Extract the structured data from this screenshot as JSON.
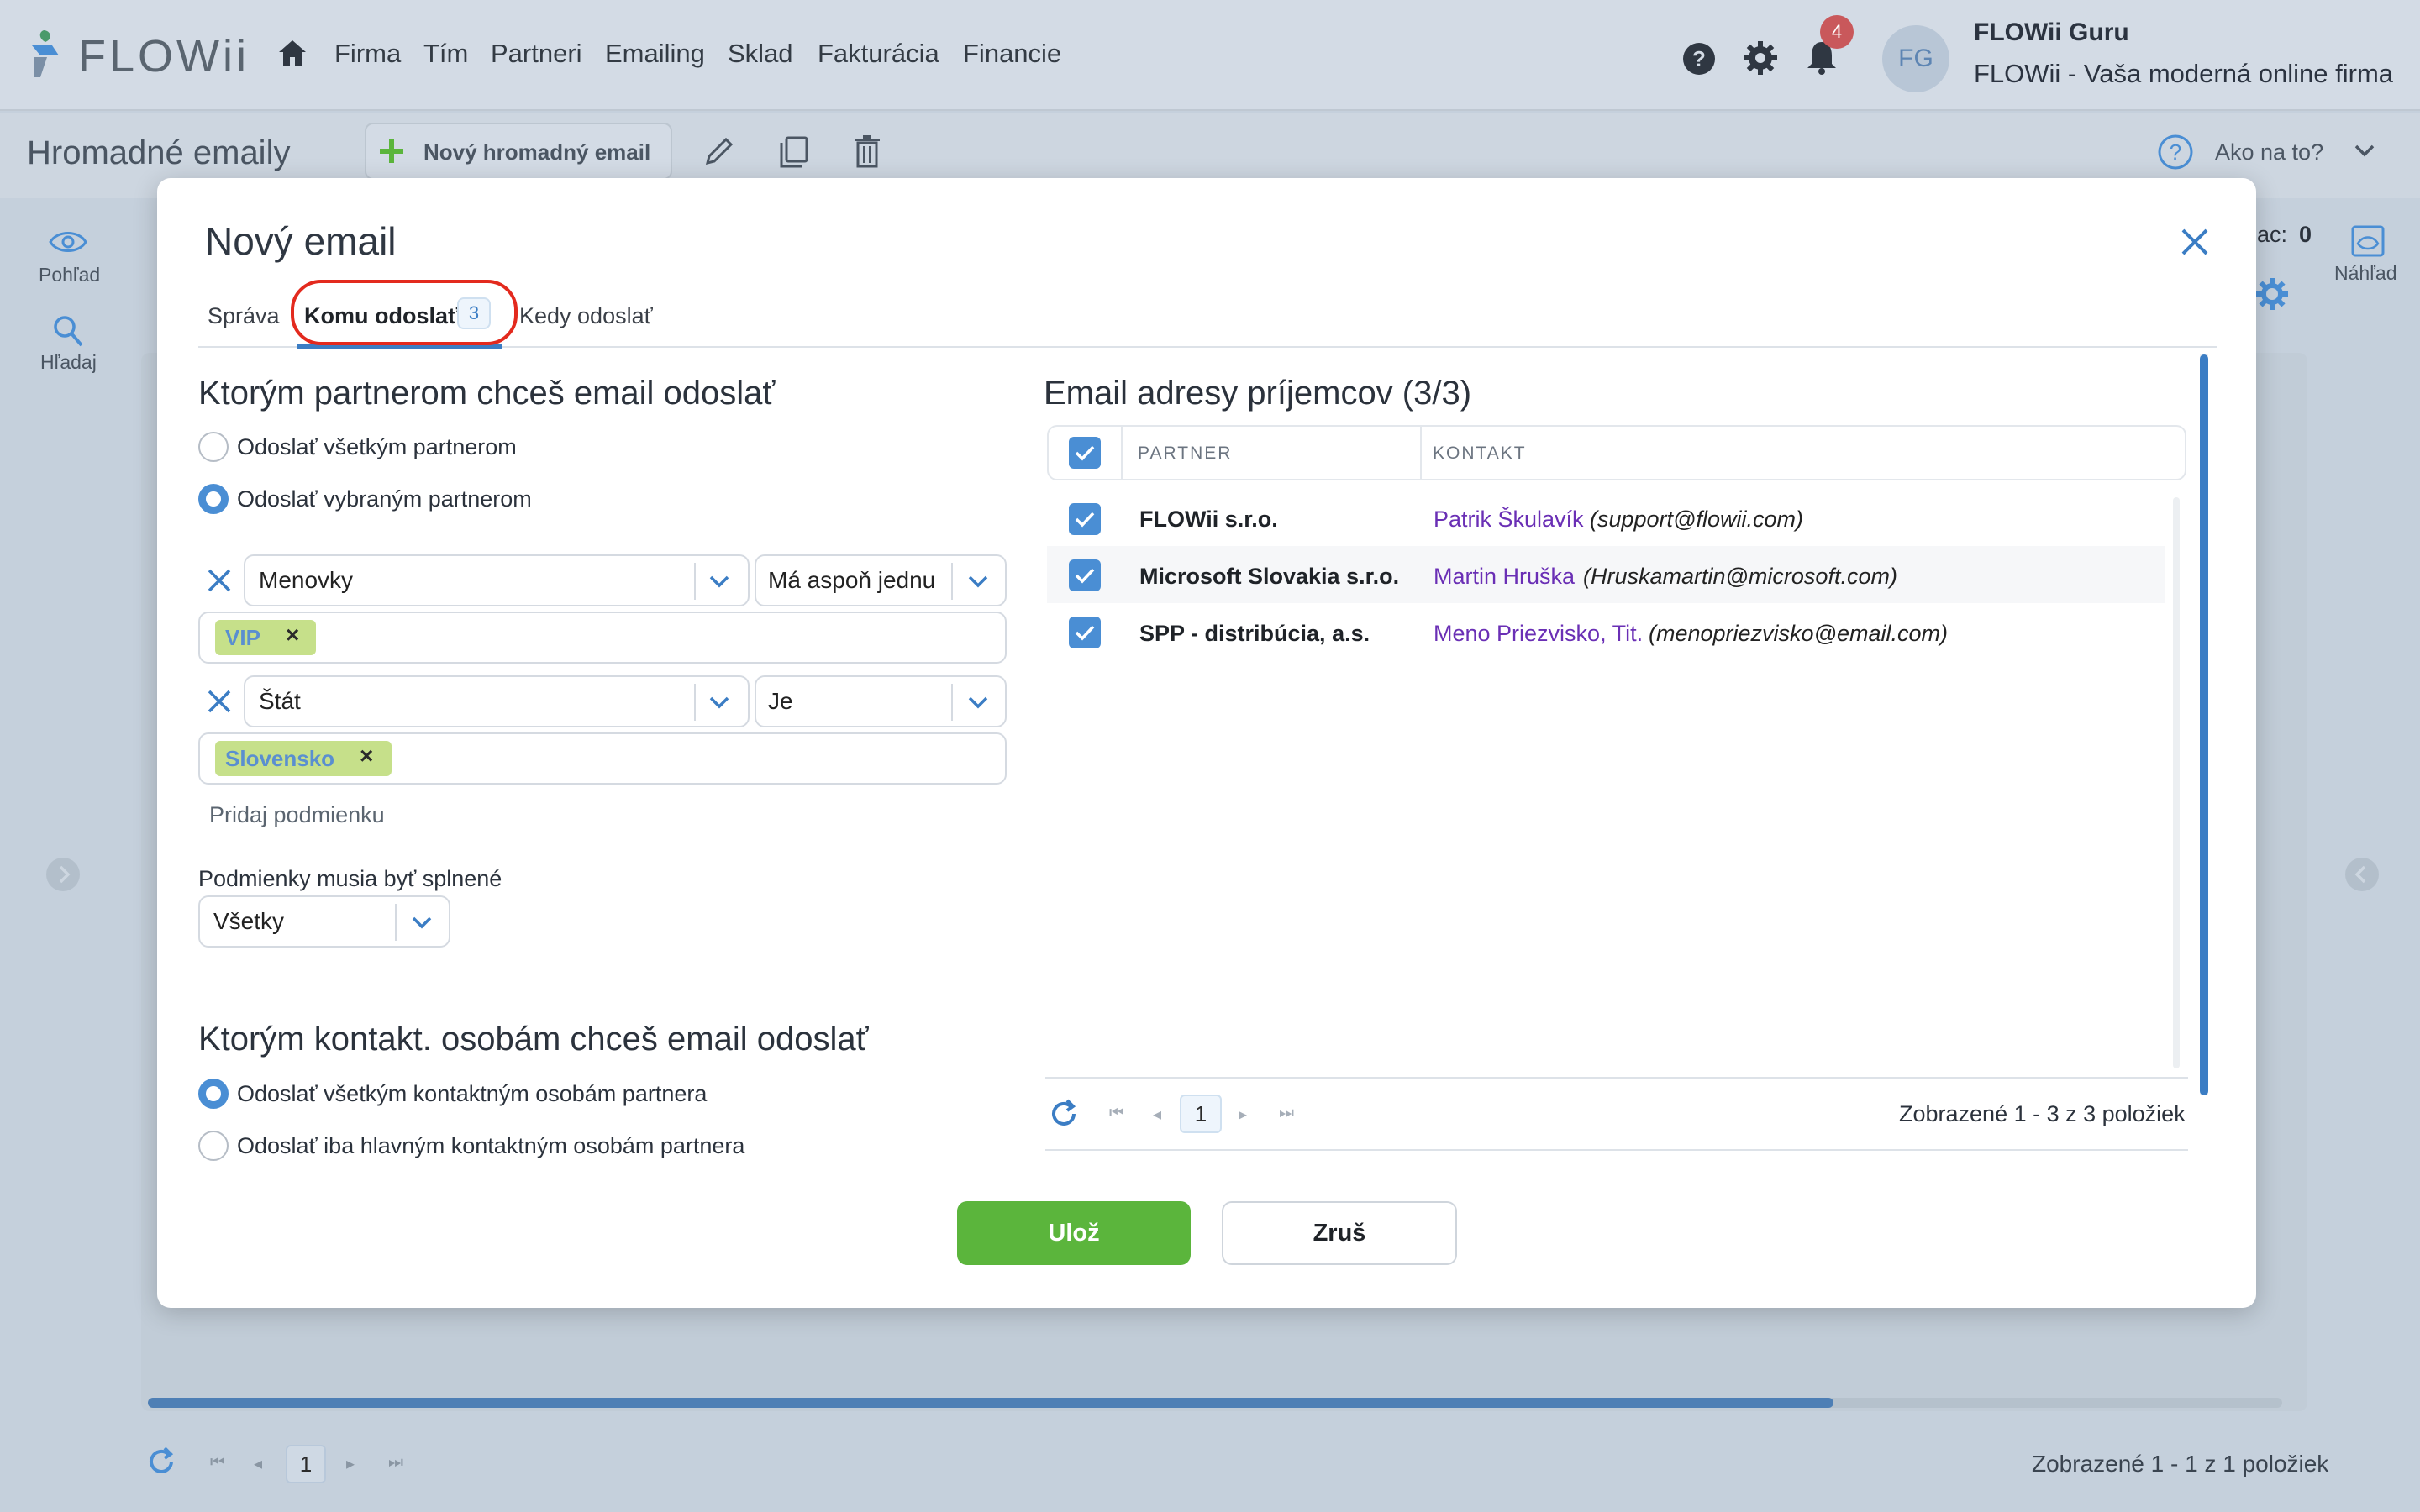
{
  "app": {
    "logo": "FLOWii",
    "nav": [
      "Firma",
      "Tím",
      "Partneri",
      "Emailing",
      "Sklad",
      "Fakturácia",
      "Financie"
    ],
    "notifications_count": "4",
    "avatar_initials": "FG",
    "user_name": "FLOWii Guru",
    "company_tagline": "FLOWii - Vaša moderná online firma"
  },
  "toolbar": {
    "page_title": "Hromadné emaily",
    "new_button": "Nový hromadný email",
    "help_label": "Ako na to?"
  },
  "side": {
    "view_label": "Pohľad",
    "search_label": "Hľadaj",
    "preview_label": "Náhľad",
    "counter_label": "ac:",
    "counter_value": "0"
  },
  "background_grid": {
    "page": "1",
    "info": "Zobrazené 1 - 1 z 1 položiek"
  },
  "modal": {
    "title": "Nový email",
    "tabs": [
      {
        "label": "Správa"
      },
      {
        "label": "Komu odoslať",
        "count": "3"
      },
      {
        "label": "Kedy odoslať"
      }
    ],
    "partners_section": {
      "title": "Ktorým partnerom chceš email odoslať",
      "option_all": "Odoslať všetkým partnerom",
      "option_selected": "Odoslať vybraným partnerom",
      "selected_option": "Odoslať vybraným partnerom",
      "conditions": [
        {
          "field": "Menovky",
          "operator": "Má aspoň jednu",
          "values": [
            "VIP"
          ]
        },
        {
          "field": "Štát",
          "operator": "Je",
          "values": [
            "Slovensko"
          ]
        }
      ],
      "add_condition": "Pridaj podmienku",
      "match_label": "Podmienky musia byť splnené",
      "match_value": "Všetky"
    },
    "contacts_section": {
      "title": "Ktorým kontakt. osobám chceš email odoslať",
      "option_all": "Odoslať všetkým kontaktným osobám partnera",
      "option_main": "Odoslať iba hlavným kontaktným osobám partnera",
      "selected_option": "Odoslať všetkým kontaktným osobám partnera"
    },
    "recipients": {
      "title": "Email adresy príjemcov (3/3)",
      "columns": [
        "PARTNER",
        "KONTAKT"
      ],
      "rows": [
        {
          "partner": "FLOWii s.r.o.",
          "contact": "Patrik Škulavík",
          "email": "(support@flowii.com)",
          "checked": true
        },
        {
          "partner": "Microsoft Slovakia s.r.o.",
          "contact": "Martin Hruška",
          "email": "(Hruskamartin@microsoft.com)",
          "checked": true
        },
        {
          "partner": "SPP - distribúcia, a.s.",
          "contact": "Meno Priezvisko, Tit.",
          "email": "(menopriezvisko@email.com)",
          "checked": true
        }
      ],
      "page": "1",
      "info": "Zobrazené 1 - 3 z 3 položiek"
    },
    "save_button": "Ulož",
    "cancel_button": "Zruš"
  },
  "colors": {
    "accent": "#3b7dc4",
    "save": "#5bb53c",
    "chip": "#c6e08a",
    "contact_link": "#6a2fb5",
    "highlight": "#e32a1e"
  }
}
